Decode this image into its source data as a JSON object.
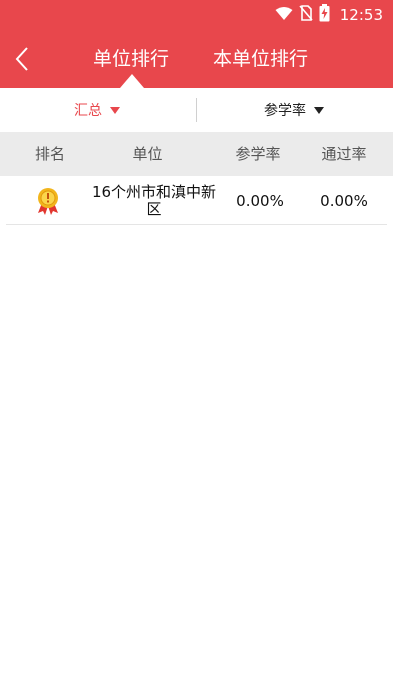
{
  "status_bar": {
    "time": "12:53",
    "icons": [
      "wifi-icon",
      "no-sim-icon",
      "battery-charging-icon"
    ]
  },
  "header": {
    "back_icon": "chevron-left-icon",
    "tabs": [
      {
        "label": "单位排行",
        "active": true
      },
      {
        "label": "本单位排行",
        "active": false
      }
    ]
  },
  "filters": {
    "scope": {
      "label": "汇总",
      "icon": "triangle-down-icon"
    },
    "metric": {
      "label": "参学率",
      "icon": "triangle-down-icon"
    }
  },
  "table": {
    "columns": [
      "排名",
      "单位",
      "参学率",
      "通过率"
    ],
    "rows": [
      {
        "rank_icon": "medal-icon",
        "unit": "16个州市和滇中新区",
        "participation_rate": "0.00%",
        "pass_rate": "0.00%"
      }
    ]
  },
  "colors": {
    "brand_red": "#e8474c",
    "header_gray": "#ebebeb"
  }
}
